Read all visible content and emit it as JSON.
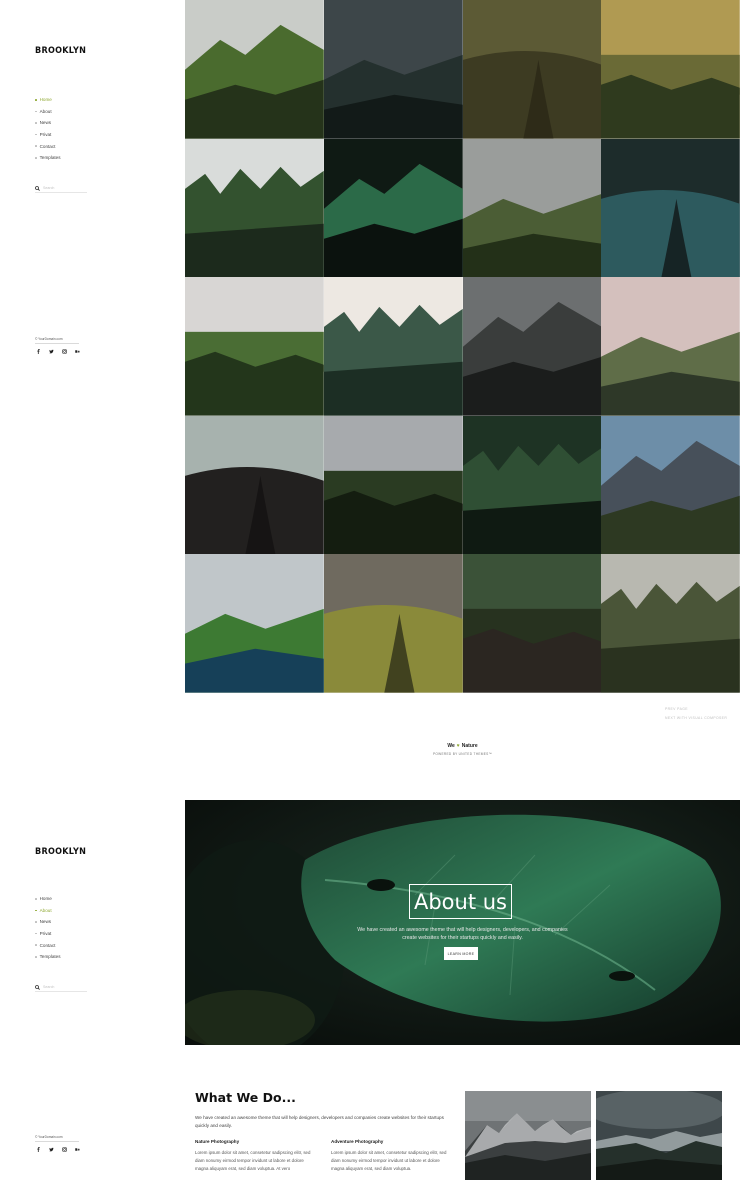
{
  "brand": "BROOKLYN",
  "nav": {
    "items": [
      "Home",
      "About",
      "News",
      "Privat",
      "Contact",
      "Templates"
    ],
    "active_first": "Home",
    "active_second": "About"
  },
  "search": {
    "placeholder": "Search"
  },
  "copyright": "© YourDomain.com",
  "social_icons": [
    "facebook-icon",
    "twitter-icon",
    "instagram-icon",
    "behance-icon"
  ],
  "pagination": {
    "prev": "PREV PAGE",
    "next": "NEXT WITH VISUAL COMPOSER"
  },
  "footer": {
    "love_before": "We",
    "love_after": "Nature",
    "powered": "POWERED BY UNITED THEMES™"
  },
  "about_hero": {
    "title": "About us",
    "text": "We have created an awesome theme that will help designers, developers, and companies create websites for their startups quickly and easily.",
    "button": "LEARN MORE"
  },
  "what_we_do": {
    "heading": "What We Do...",
    "intro": "We have created an awesome theme that will help designers, developers and companies create websites for their startups quickly and easily.",
    "columns": [
      {
        "title": "Nature Photography",
        "text": "Lorem ipsum dolor sit amet, consetetur sadipscing elitr, sed diam nonumy eirmod tempor invidunt ut labore et dolore magna aliquyam erat, sed diam voluptua. At vero"
      },
      {
        "title": "Adventure Photography",
        "text": "Lorem ipsum dolor sit amet, consetetur sadipscing elitr, sed diam nonumy eirmod tempor invidunt ut labore et dolore magna aliquyam erat, sed diam voluptua."
      }
    ]
  },
  "gallery": [
    {
      "scene": "green cliffs and winding road",
      "colors": [
        "#c9ccc8",
        "#4a6b2e",
        "#25331a"
      ]
    },
    {
      "scene": "dark stormy valley",
      "colors": [
        "#3d4649",
        "#24302e",
        "#121a18"
      ]
    },
    {
      "scene": "aerial winding road",
      "colors": [
        "#5c5a35",
        "#3d3b22",
        "#2a2816"
      ]
    },
    {
      "scene": "golden sunset mountains",
      "colors": [
        "#b09a52",
        "#6a6a36",
        "#2f3a1e"
      ]
    },
    {
      "scene": "forest coastline",
      "colors": [
        "#d9dcda",
        "#33522f",
        "#1c2a1c"
      ]
    },
    {
      "scene": "green leaf close up",
      "colors": [
        "#0f1a14",
        "#2b6a48",
        "#0b120e"
      ]
    },
    {
      "scene": "foggy plateau",
      "colors": [
        "#9a9d9b",
        "#4b5d35",
        "#233018"
      ]
    },
    {
      "scene": "dark lake",
      "colors": [
        "#1d2c2b",
        "#2d5a5e",
        "#101716"
      ]
    },
    {
      "scene": "green valley hills",
      "colors": [
        "#d8d6d4",
        "#4a6d34",
        "#23361b"
      ]
    },
    {
      "scene": "misty pine forest",
      "colors": [
        "#ede8e2",
        "#3b5848",
        "#1c2e24"
      ]
    },
    {
      "scene": "snowy dark peaks",
      "colors": [
        "#6c6f70",
        "#3a3d3c",
        "#1b1d1c"
      ]
    },
    {
      "scene": "pink misty meadow",
      "colors": [
        "#d4c0bd",
        "#5f6d48",
        "#2e3828"
      ]
    },
    {
      "scene": "lake with dark forest",
      "colors": [
        "#a7b2ae",
        "#22201f",
        "#141211"
      ]
    },
    {
      "scene": "cloudy forest hills",
      "colors": [
        "#a7aaad",
        "#2a3b22",
        "#141d10"
      ]
    },
    {
      "scene": "forest suspension bridge",
      "colors": [
        "#1e3324",
        "#2f4f34",
        "#0f1a12"
      ]
    },
    {
      "scene": "alpine peaks with hikers",
      "colors": [
        "#6d8ea8",
        "#47505a",
        "#2d3922"
      ]
    },
    {
      "scene": "sea cliffs and lagoon",
      "colors": [
        "#c0c6c9",
        "#3d7a33",
        "#164058"
      ]
    },
    {
      "scene": "golden misty valley",
      "colors": [
        "#6f6a5f",
        "#8a8a3a",
        "#2e3019"
      ]
    },
    {
      "scene": "wooden forest bridge",
      "colors": [
        "#3b5238",
        "#27321f",
        "#2b2621"
      ]
    },
    {
      "scene": "foggy forest hillside",
      "colors": [
        "#b8b8b0",
        "#4a5538",
        "#2a321f"
      ]
    }
  ],
  "photos": [
    {
      "scene": "snowy peaks under grey sky"
    },
    {
      "scene": "stormy mountain range"
    }
  ]
}
